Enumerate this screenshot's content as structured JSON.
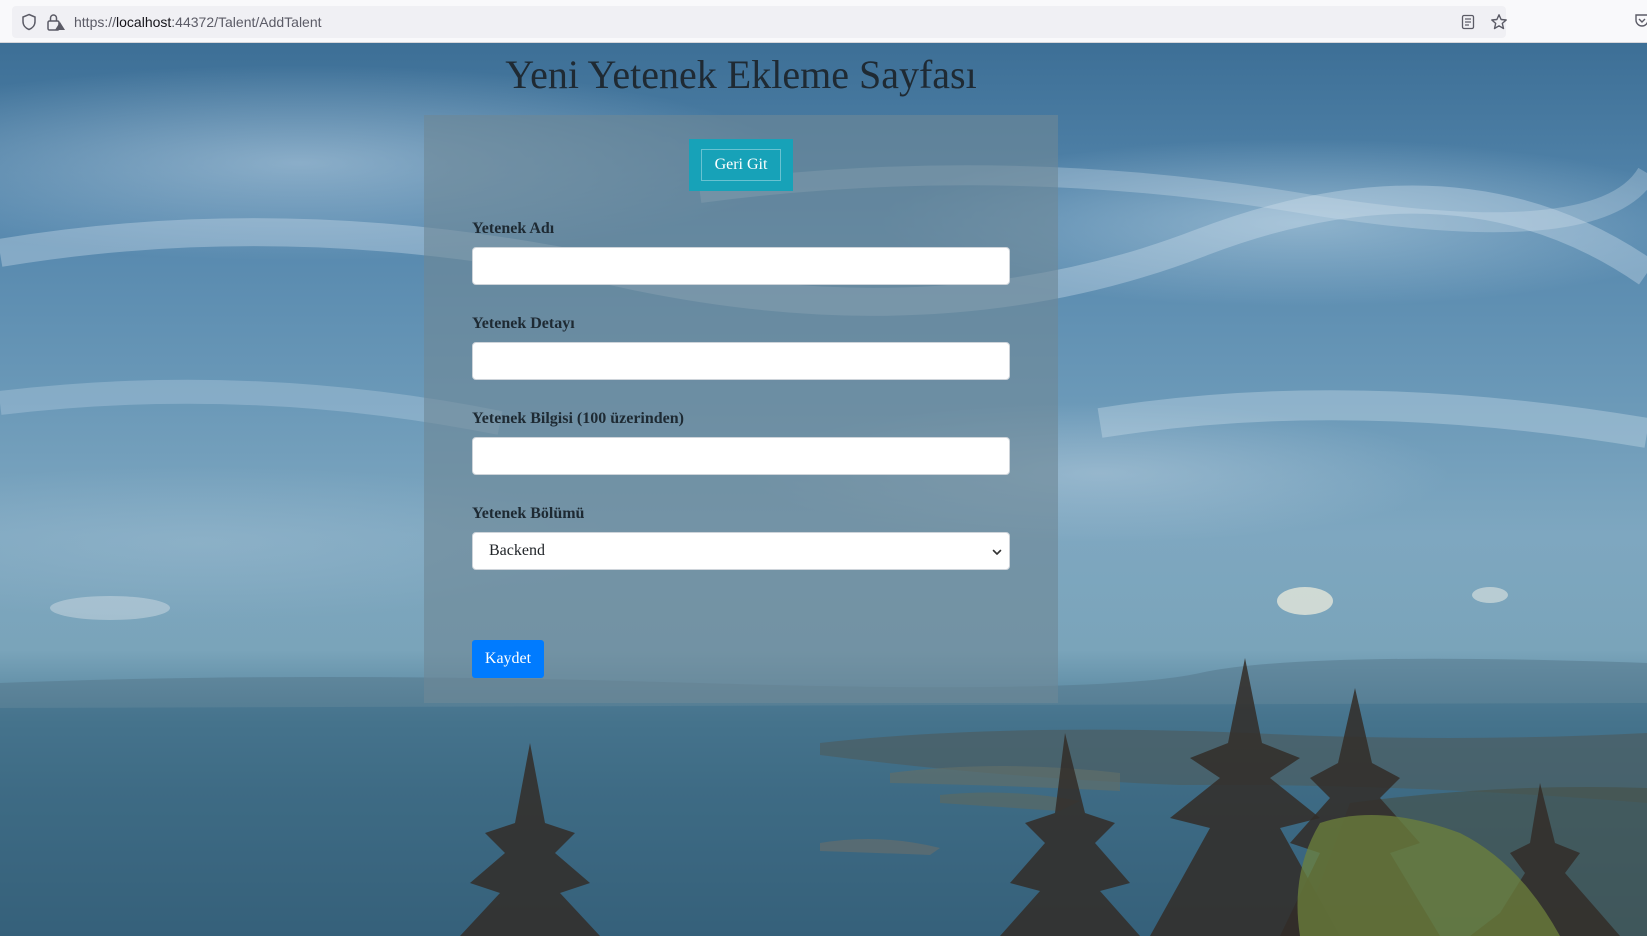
{
  "browser": {
    "url_scheme": "https://",
    "url_host": "localhost",
    "url_rest": ":44372/Talent/AddTalent"
  },
  "page": {
    "title": "Yeni Yetenek Ekleme Sayfası",
    "back_button": "Geri Git",
    "fields": {
      "name": {
        "label": "Yetenek Adı",
        "value": ""
      },
      "detail": {
        "label": "Yetenek Detayı",
        "value": ""
      },
      "level": {
        "label": "Yetenek Bilgisi (100 üzerinden)",
        "value": ""
      },
      "section": {
        "label": "Yetenek Bölümü",
        "selected": "Backend"
      }
    },
    "save_button": "Kaydet"
  },
  "colors": {
    "back_button": "#17a2b8",
    "save_button": "#007bff"
  }
}
